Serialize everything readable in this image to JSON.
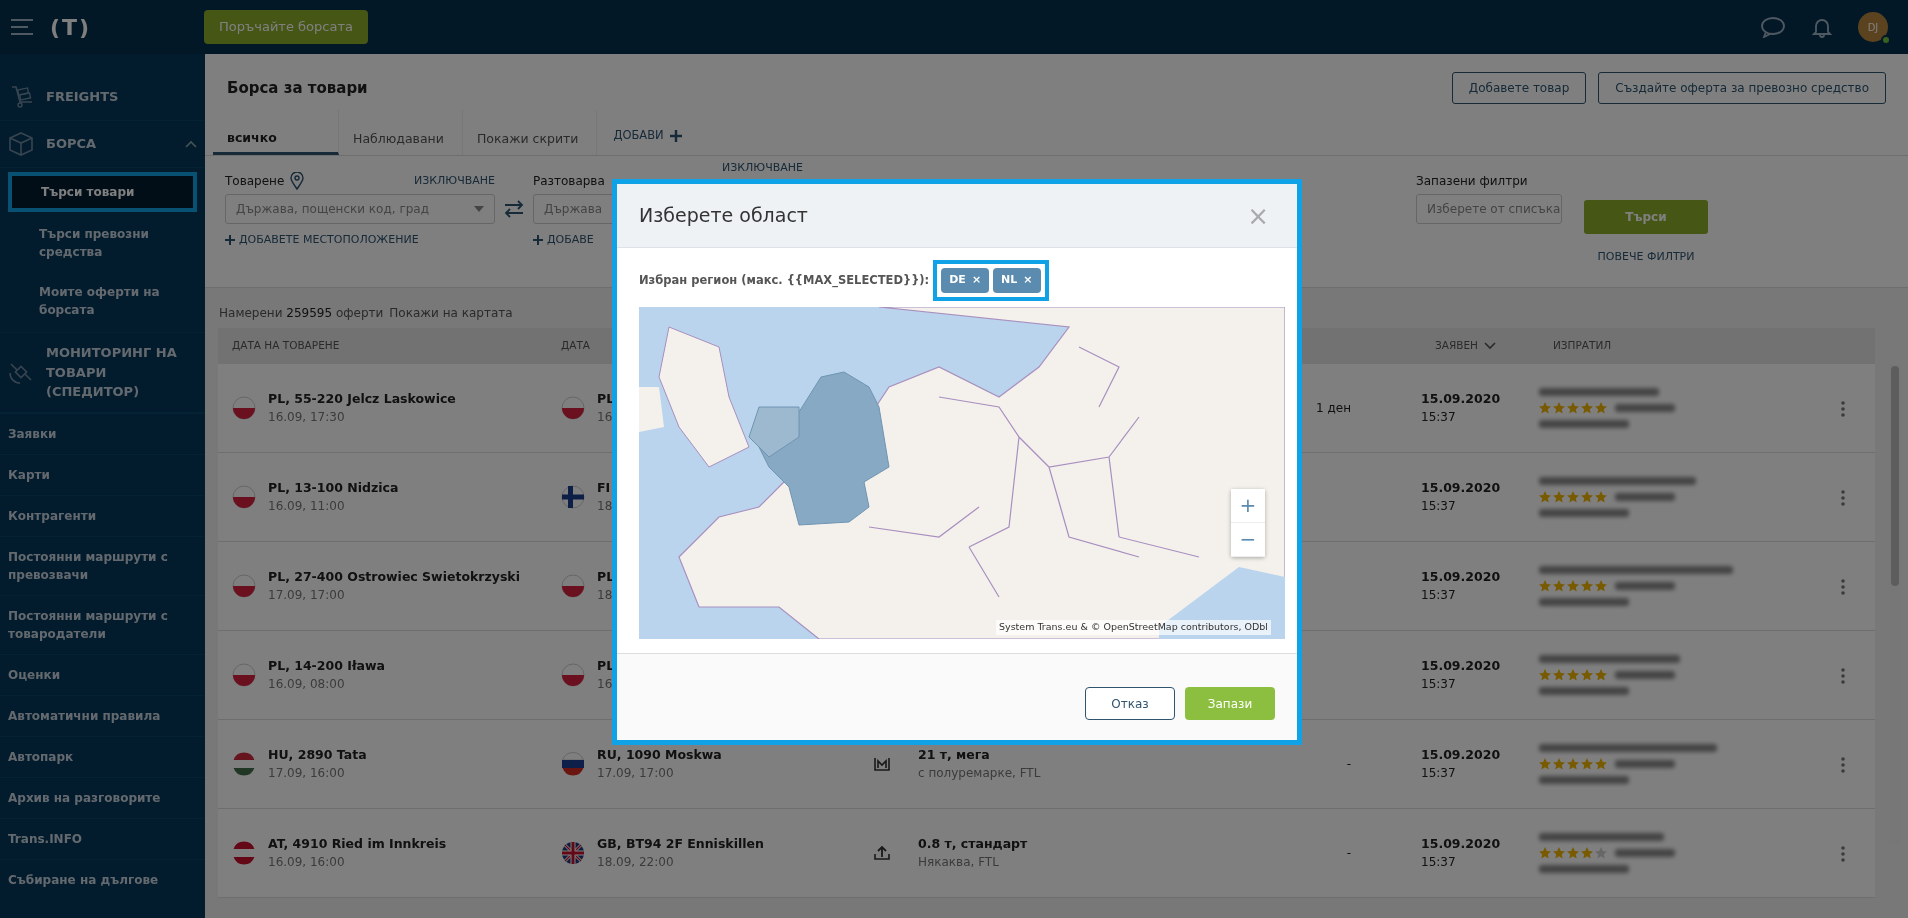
{
  "topbar": {
    "logo_text": "(T)",
    "order_button": "Поръчайте борсата",
    "avatar_initials": "DJ",
    "online": true
  },
  "sidebar": {
    "groups": [
      {
        "label": "FREIGHTS"
      },
      {
        "label": "БОРСА",
        "expanded": true,
        "children": [
          {
            "label": "Търси товари",
            "selected": true,
            "highlighted": true
          },
          {
            "label": "Търси превозни средства",
            "selected": false,
            "highlighted": false
          },
          {
            "label": "Моите оферти на борсата",
            "selected": false,
            "highlighted": false
          }
        ]
      },
      {
        "label": "МОНИТОРИНГ НА ТОВАРИ (СПЕДИТОР)"
      }
    ],
    "links": [
      "Заявки",
      "Карти",
      "Контрагенти",
      "Постоянни маршрути с превозвачи",
      "Постоянни маршрути с товародатели",
      "Оценки",
      "Автоматични правила",
      "Автопарк",
      "Архив на разговорите",
      "Trans.INFO",
      "Събиране на дългове"
    ]
  },
  "page": {
    "title": "Борса за товари",
    "buttons": [
      "Добавете товар",
      "Създайте оферта за превозно средство"
    ],
    "tabs": [
      {
        "label": "всичко",
        "selected": true
      },
      {
        "label": "Наблюдавани",
        "selected": false
      },
      {
        "label": "Покажи скрити",
        "selected": false
      }
    ],
    "add_tab": "ДОБАВИ"
  },
  "filters": {
    "loading": {
      "label": "Товарене",
      "exclude": "ИЗКЛЮЧВАНЕ",
      "placeholder": "Държава, пощенски код, град",
      "add": "ДОБАВЕТЕ МЕСТОПОЛОЖЕНИЕ"
    },
    "unloading": {
      "label": "Разтоварва",
      "exclude": "ИЗКЛЮЧВАНЕ",
      "placeholder": "Държава",
      "add": "ДОБАВЕ"
    },
    "saved": {
      "label": "Запазени филтри",
      "placeholder": "Изберете от списъка"
    },
    "search_button": "Търси",
    "more": "ПОВЕЧЕ ФИЛТРИ"
  },
  "results": {
    "summary": "Намерени **259595** оферти",
    "map_link": "Покажи на картата"
  },
  "table": {
    "columns": [
      "ДАТА НА ТОВАРЕНЕ",
      "ДАТА",
      "ЗАЯВЕН",
      "ИЗПРАТИЛ"
    ],
    "rows": [
      {
        "from": {
          "kind": "pl",
          "place": "PL, 55-220 Jelcz Laskowice",
          "time": "16.09, 17:30"
        },
        "to": {
          "kind": "pl",
          "place": "PL",
          "time": "16"
        },
        "period": "1 ден",
        "date": "15.09.2020",
        "time": "15:37",
        "stars": 5
      },
      {
        "from": {
          "kind": "pl",
          "place": "PL, 13-100 Nidzica",
          "time": "16.09, 11:00"
        },
        "to": {
          "kind": "fi",
          "place": "FI",
          "time": "18"
        },
        "date": "15.09.2020",
        "time": "15:37",
        "stars": 5
      },
      {
        "from": {
          "kind": "pl",
          "place": "PL, 27-400 Ostrowiec Swietokrzyski",
          "time": "17.09, 17:00"
        },
        "to": {
          "kind": "pl",
          "place": "PL",
          "time": "18"
        },
        "date": "15.09.2020",
        "time": "15:37",
        "stars": 5
      },
      {
        "from": {
          "kind": "pl",
          "place": "PL, 14-200 Iława",
          "time": "16.09, 08:00"
        },
        "to": {
          "kind": "pl",
          "place": "PL",
          "time": "16"
        },
        "date": "15.09.2020",
        "time": "15:37",
        "stars": 5
      },
      {
        "from": {
          "kind": "hu",
          "place": "HU, 2890 Tata",
          "time": "17.09, 16:00"
        },
        "to": {
          "kind": "ru",
          "place": "RU, 1090 Moskwa",
          "time": "17.09, 17:00"
        },
        "cargo": {
          "kind": "trailer",
          "size": "21 т, мега",
          "detail": "с полуремарке, FTL"
        },
        "period": "-",
        "date": "15.09.2020",
        "time": "15:37",
        "stars": 5
      },
      {
        "from": {
          "kind": "at",
          "place": "AT, 4910 Ried im Innkreis",
          "time": "16.09, 16:00"
        },
        "to": {
          "kind": "gb",
          "place": "GB, BT94 2F Enniskillen",
          "time": "18.09, 22:00"
        },
        "cargo": {
          "kind": "upload",
          "size": "0.8 т, стандарт",
          "detail": "Някаква, FTL"
        },
        "period": "-",
        "date": "15.09.2020",
        "time": "15:37",
        "stars": 4
      }
    ]
  },
  "modal": {
    "title": "Изберете област",
    "highlighted": true,
    "close": "×",
    "label": "Избран регион (макс. {{MAX_SELECTED}}):",
    "chips_highlighted": true,
    "chips": [
      {
        "label": "DE",
        "remove": "×"
      },
      {
        "label": "NL",
        "remove": "×"
      }
    ],
    "zoom_in": "+",
    "zoom_out": "−",
    "attribution": "System Trans.eu & ",
    "attribution_link": "© OpenStreetMap contributors, ODbl",
    "buttons": [
      {
        "label": "Отказ",
        "kind": "secondary"
      },
      {
        "label": "Запази",
        "kind": "primary"
      }
    ]
  }
}
